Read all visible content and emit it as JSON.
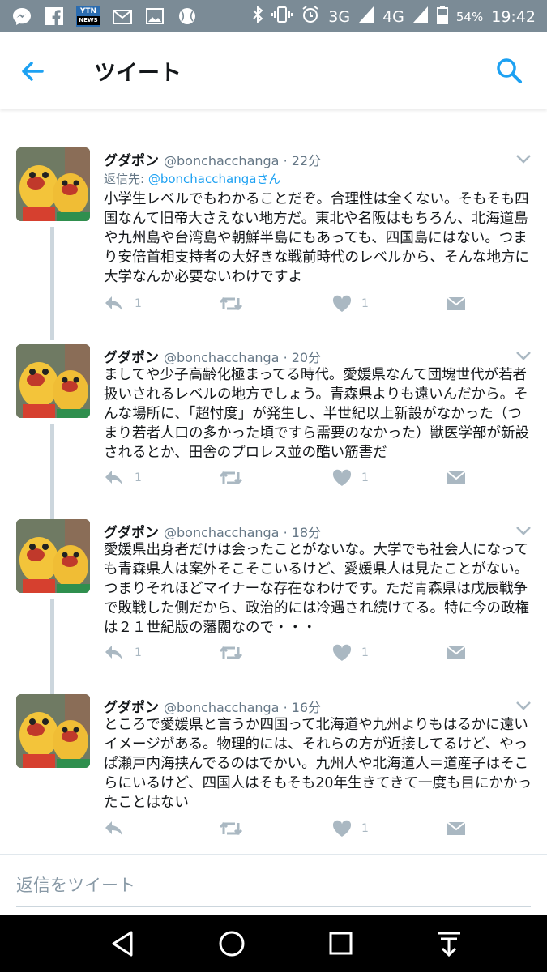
{
  "status_bar": {
    "network_3g": "3G",
    "network_4g": "4G",
    "battery": "54%",
    "time": "19:42",
    "left_icons": [
      "messenger-icon",
      "facebook-icon",
      "ytn-news-icon",
      "mail-icon",
      "image-icon",
      "baseball-icon"
    ],
    "ytn_label": "YTN",
    "ytn_sub": "NEWS"
  },
  "app_bar": {
    "title": "ツイート"
  },
  "tweets": [
    {
      "name": "グダポン",
      "handle": "@bonchacchanga",
      "time": "· 22分",
      "reply_prefix": "返信先:",
      "reply_to": "@bonchacchangaさん",
      "text": "小学生レベルでもわかることだぞ。合理性は全くない。そもそも四国なんて旧帝大さえない地方だ。東北や名阪はもちろん、北海道島や九州島や台湾島や朝鮮半島にもあっても、四国島にはない。つまり安倍首相支持者の大好きな戦前時代のレベルから、そんな地方に大学なんか必要ないわけですよ",
      "reply_count": "1",
      "like_count": "1"
    },
    {
      "name": "グダポン",
      "handle": "@bonchacchanga",
      "time": "· 20分",
      "text": "ましてや少子高齢化極まってる時代。愛媛県なんて団塊世代が若者扱いされるレベルの地方でしょう。青森県よりも遠いんだから。そんな場所に、「超忖度」が発生し、半世紀以上新設がなかった（つまり若者人口の多かった頃ですら需要のなかった）獣医学部が新設されるとか、田舎のプロレス並の酷い筋書だ",
      "reply_count": "1",
      "like_count": "1"
    },
    {
      "name": "グダポン",
      "handle": "@bonchacchanga",
      "time": "· 18分",
      "text": "愛媛県出身者だけは会ったことがないな。大学でも社会人になっても青森県人は案外そこそこいるけど、愛媛県人は見たことがない。つまりそれほどマイナーな存在なわけです。ただ青森県は戊辰戦争で敗戦した側だから、政治的には冷遇され続けてる。特に今の政権は２１世紀版の藩閥なので・・・",
      "reply_count": "1",
      "like_count": "1"
    },
    {
      "name": "グダポン",
      "handle": "@bonchacchanga",
      "time": "· 16分",
      "text": "ところで愛媛県と言うか四国って北海道や九州よりもはるかに遠いイメージがある。物理的には、それらの方が近接してるけど、やっぱ瀬戸内海挟んでるのはでかい。九州人や北海道人＝道産子はそこらにいるけど、四国人はそもそも20年生きてきて一度も目にかかったことはない",
      "reply_count": "",
      "like_count": "1"
    }
  ],
  "compose": {
    "placeholder": "返信をツイート"
  },
  "colors": {
    "status_bar": "#7b8b96",
    "accent": "#1da1f2",
    "icon_gray": "#aab8c2",
    "thread_line": "#ccd6dd"
  }
}
